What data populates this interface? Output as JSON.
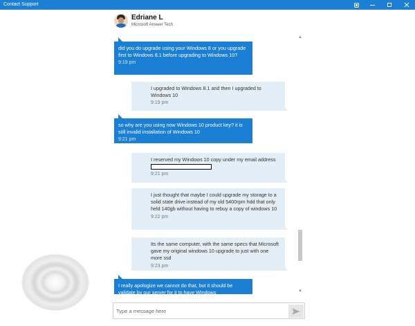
{
  "window": {
    "title": "Contact Support"
  },
  "agent": {
    "name": "Edriane L",
    "role": "Microsoft Answer Tech"
  },
  "messages": [
    {
      "sender": "agent",
      "text": "did you do upgrade using your Windows 8 or you upgrade first to Windows 8.1 before upgrading to Windows 10?",
      "time": "9:19 pm"
    },
    {
      "sender": "user",
      "text": "I upgraded to Windows 8.1 and then I upgraded to Windows 10",
      "time": "9:19 pm"
    },
    {
      "sender": "agent",
      "text": "so why are you using now Windows 10 product key? it is still invalid installation of Windows 10",
      "time": "9:21 pm"
    },
    {
      "sender": "user",
      "text": "I reserved my Windows 10 copy under my email address",
      "time": "9:21 pm"
    },
    {
      "sender": "user",
      "text": "I just thought that maybe I could upgrade my storage to a solid state drive instead of my old 5400rpm hdd that only held 140gb without having to rebuy a copy of windows 10",
      "time": "9:22 pm"
    },
    {
      "sender": "user",
      "text": "Its the same computer, with the same specs that Microsoft gave my original windows 10 upgrade to just with one more ssd",
      "time": "9:23 pm"
    },
    {
      "sender": "agent",
      "text": "I really apologize we cannot do that, but it should be validate by our server for it to have Windows",
      "time": ""
    }
  ],
  "composer": {
    "placeholder": "Type a message here"
  },
  "scroll": {
    "position": 0.82
  },
  "colors": {
    "accent": "#1b7fd6",
    "user_bubble": "#e3eef7"
  },
  "icons": [
    "chat-icon",
    "minimize-icon",
    "maximize-icon",
    "close-icon",
    "send-icon",
    "loading-spinner-icon"
  ]
}
